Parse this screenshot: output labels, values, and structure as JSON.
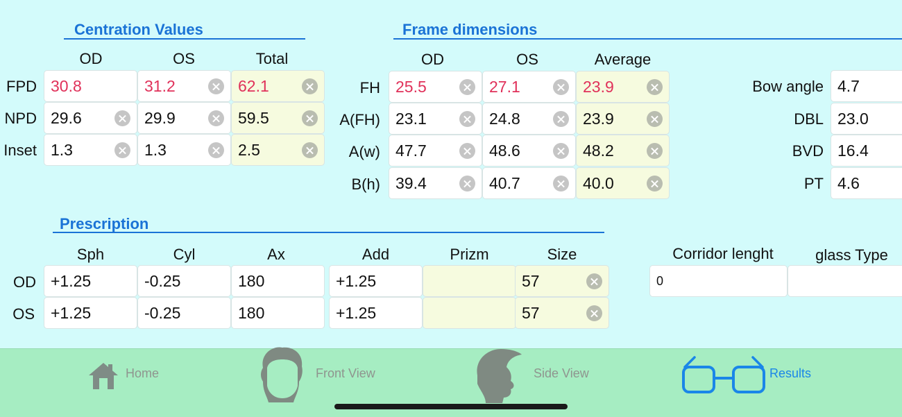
{
  "centration": {
    "title": "Centration Values",
    "columns": [
      "OD",
      "OS",
      "Total"
    ],
    "rows": [
      {
        "label": "FPD",
        "values": [
          "30.8",
          "31.2",
          "62.1"
        ]
      },
      {
        "label": "NPD",
        "values": [
          "29.6",
          "29.9",
          "59.5"
        ]
      },
      {
        "label": "Inset",
        "values": [
          "1.3",
          "1.3",
          "2.5"
        ]
      }
    ]
  },
  "frame": {
    "title": "Frame dimensions",
    "columns": [
      "OD",
      "OS",
      "Average"
    ],
    "rows": [
      {
        "label": "FH",
        "values": [
          "25.5",
          "27.1",
          "23.9"
        ]
      },
      {
        "label": "A(FH)",
        "values": [
          "23.1",
          "24.8",
          "23.9"
        ]
      },
      {
        "label": "A(w)",
        "values": [
          "47.7",
          "48.6",
          "48.2"
        ]
      },
      {
        "label": "B(h)",
        "values": [
          "39.4",
          "40.7",
          "40.0"
        ]
      }
    ]
  },
  "extra": {
    "rows": [
      {
        "label": "Bow angle",
        "value": "4.7"
      },
      {
        "label": "DBL",
        "value": "23.0"
      },
      {
        "label": "BVD",
        "value": "16.4"
      },
      {
        "label": "PT",
        "value": "4.6"
      }
    ]
  },
  "prescription": {
    "title": "Prescription",
    "columns": [
      "Sph",
      "Cyl",
      "Ax",
      "Add",
      "Prizm",
      "Size"
    ],
    "rows": [
      {
        "label": "OD",
        "values": [
          "+1.25",
          "-0.25",
          "180",
          "+1.25",
          "",
          "57"
        ]
      },
      {
        "label": "OS",
        "values": [
          "+1.25",
          "-0.25",
          "180",
          "+1.25",
          "",
          "57"
        ]
      }
    ],
    "corridor_label": "Corridor lenght",
    "corridor_value": "0",
    "glass_type_label": "glass Type",
    "glass_type_value": ""
  },
  "tabs": [
    {
      "label": "Home",
      "icon": "home-icon"
    },
    {
      "label": "Front View",
      "icon": "front-view-head-icon"
    },
    {
      "label": "Side View",
      "icon": "side-view-head-icon"
    },
    {
      "label": "Results",
      "icon": "glasses-icon",
      "active": true
    }
  ],
  "colors": {
    "background": "#d3fbfb",
    "accent": "#1a73d6",
    "highlight_value": "#e0315a",
    "tab_bar": "#a6edc2",
    "computed_cell": "#f6fbdf"
  }
}
